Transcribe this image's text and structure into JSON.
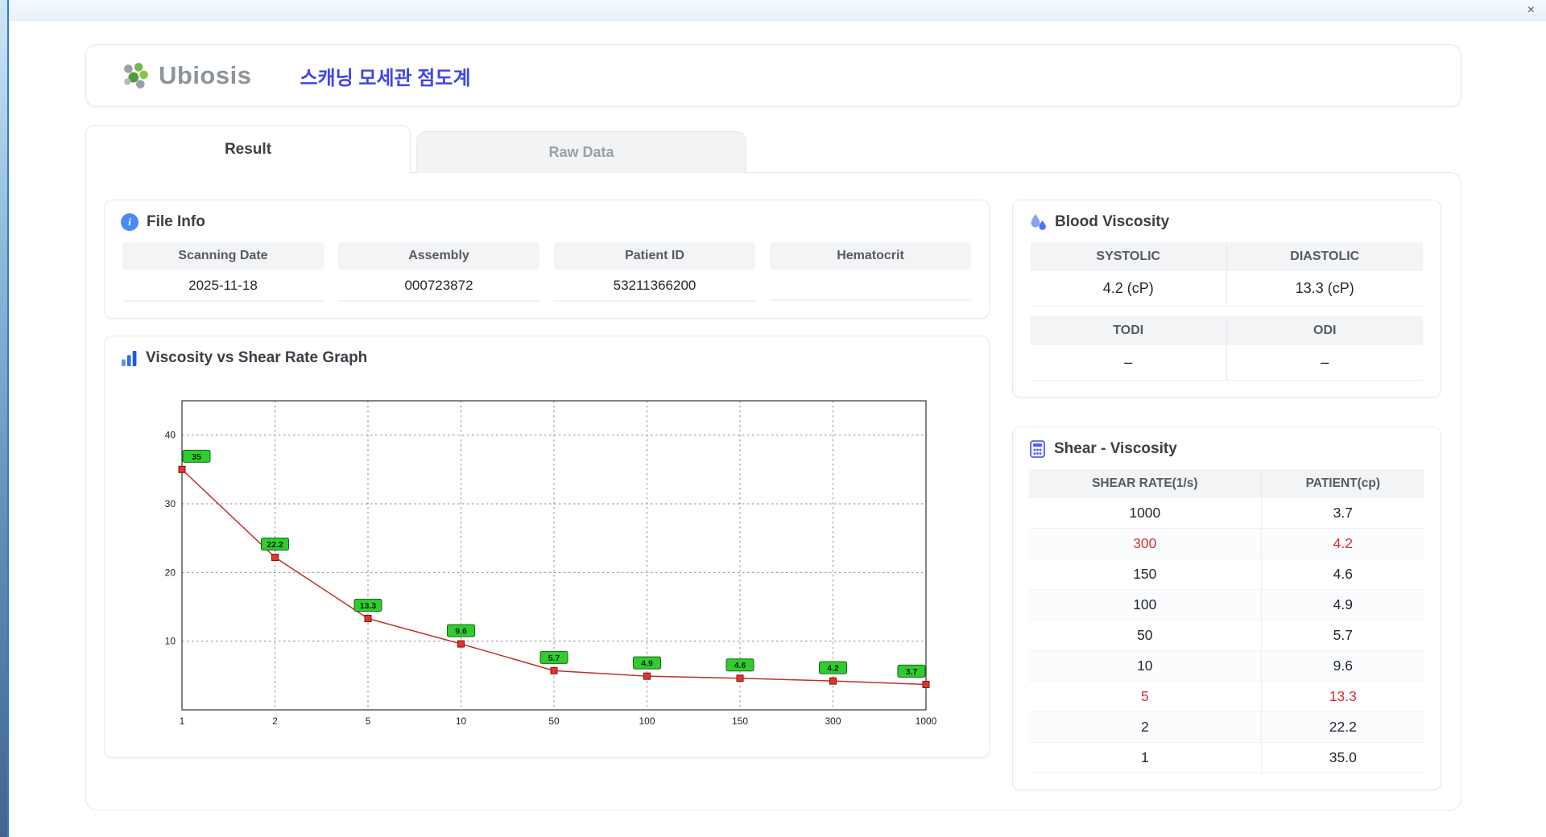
{
  "window": {
    "close_glyph": "×"
  },
  "header": {
    "logo_text": "Ubiosis",
    "app_title": "스캐닝 모세관 점도계"
  },
  "tabs": [
    {
      "label": "Result"
    },
    {
      "label": "Raw Data"
    }
  ],
  "file_info": {
    "title": "File Info",
    "icon_glyph": "i",
    "fields": [
      {
        "label": "Scanning Date",
        "value": "2025-11-18"
      },
      {
        "label": "Assembly",
        "value": "000723872"
      },
      {
        "label": "Patient ID",
        "value": "53211366200"
      },
      {
        "label": "Hematocrit",
        "value": ""
      }
    ]
  },
  "blood_viscosity": {
    "title": "Blood Viscosity",
    "cells": [
      {
        "label": "SYSTOLIC",
        "value": "4.2 (cP)"
      },
      {
        "label": "DIASTOLIC",
        "value": "13.3 (cP)"
      },
      {
        "label": "TODI",
        "value": "–"
      },
      {
        "label": "ODI",
        "value": "–"
      }
    ]
  },
  "graph": {
    "title": "Viscosity vs Shear Rate Graph"
  },
  "chart_data": {
    "type": "line",
    "title": "Viscosity vs Shear Rate Graph",
    "x": [
      1,
      2,
      5,
      10,
      50,
      100,
      150,
      300,
      1000
    ],
    "values": [
      35,
      22.2,
      13.3,
      9.6,
      5.7,
      4.9,
      4.6,
      4.2,
      3.7
    ],
    "labels": [
      "35",
      "22.2",
      "13.3",
      "9.6",
      "5.7",
      "4.9",
      "4.6",
      "4.2",
      "3.7"
    ],
    "xlabel": "",
    "ylabel": "",
    "x_scale": "log-category",
    "ylim": [
      0,
      45
    ],
    "yticks": [
      10,
      20,
      30,
      40
    ],
    "grid": "dashed",
    "legend": "none",
    "line_color": "#c03028",
    "marker_color": "#e5342a",
    "label_bg": "#30cc30"
  },
  "shear_table": {
    "title": "Shear - Viscosity",
    "columns": [
      "SHEAR RATE(1/s)",
      "PATIENT(cp)"
    ],
    "rows": [
      {
        "rate": "1000",
        "patient": "3.7",
        "highlight": false
      },
      {
        "rate": "300",
        "patient": "4.2",
        "highlight": true
      },
      {
        "rate": "150",
        "patient": "4.6",
        "highlight": false
      },
      {
        "rate": "100",
        "patient": "4.9",
        "highlight": false
      },
      {
        "rate": "50",
        "patient": "5.7",
        "highlight": false
      },
      {
        "rate": "10",
        "patient": "9.6",
        "highlight": false
      },
      {
        "rate": "5",
        "patient": "13.3",
        "highlight": true
      },
      {
        "rate": "2",
        "patient": "22.2",
        "highlight": false
      },
      {
        "rate": "1",
        "patient": "35.0",
        "highlight": false
      }
    ]
  },
  "colors": {
    "accent_blue": "#3f46e6",
    "line_red": "#c03028",
    "marker_red": "#e5342a",
    "label_green": "#30cc30",
    "highlight_red": "#d63031",
    "header_gray_bg": "#f3f4f6"
  }
}
